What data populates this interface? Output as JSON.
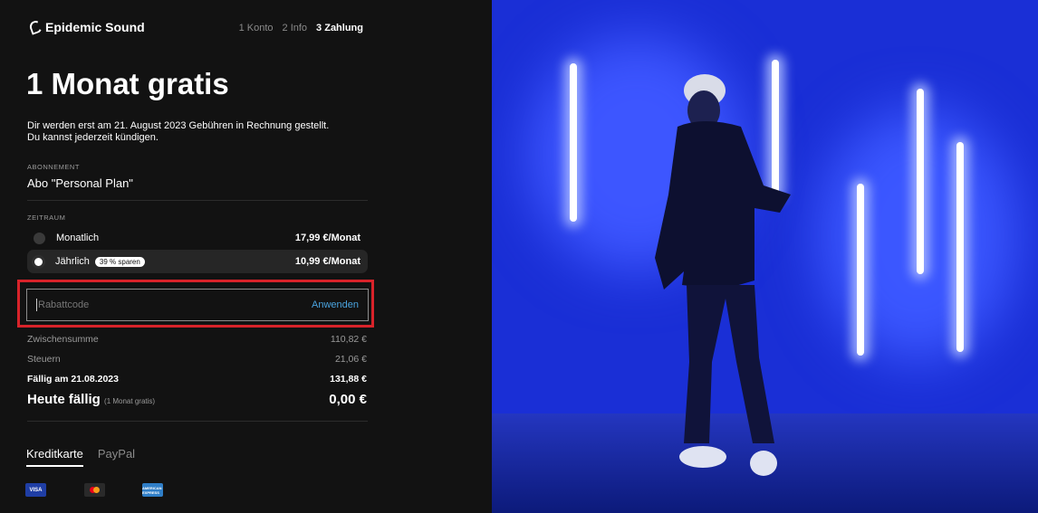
{
  "brand": {
    "name": "Epidemic Sound"
  },
  "steps": [
    {
      "label": "1 Konto"
    },
    {
      "label": "2 Info"
    },
    {
      "label": "3 Zahlung"
    }
  ],
  "headline": "1 Monat gratis",
  "notice": {
    "line1": "Dir werden erst am 21. August 2023 Gebühren in Rechnung gestellt.",
    "line2": "Du kannst jederzeit kündigen."
  },
  "subscription": {
    "label": "ABONNEMENT",
    "plan": "Abo \"Personal Plan\""
  },
  "period": {
    "label": "ZEITRAUM",
    "options": [
      {
        "label": "Monatlich",
        "badge": "",
        "price": "17,99 €/Monat",
        "selected": false
      },
      {
        "label": "Jährlich",
        "badge": "39 % sparen",
        "price": "10,99 €/Monat",
        "selected": true
      }
    ]
  },
  "coupon": {
    "placeholder": "Rabattcode",
    "apply_label": "Anwenden"
  },
  "summary": {
    "subtotal_label": "Zwischensumme",
    "subtotal_value": "110,82 €",
    "tax_label": "Steuern",
    "tax_value": "21,06 €",
    "due_date_label": "Fällig am 21.08.2023",
    "due_date_value": "131,88 €",
    "today_label": "Heute fällig",
    "today_note": "(1 Monat gratis)",
    "today_value": "0,00 €"
  },
  "payment": {
    "tabs": [
      {
        "label": "Kreditkarte",
        "active": true
      },
      {
        "label": "PayPal",
        "active": false
      }
    ],
    "cards": [
      {
        "name": "visa-icon",
        "text": "VISA"
      },
      {
        "name": "mastercard-icon",
        "text": ""
      },
      {
        "name": "amex-icon",
        "text": "AMERICAN EXPRESS"
      }
    ]
  },
  "colors": {
    "background": "#121212",
    "accent_link": "#4aa3df",
    "highlight_box": "#d8232a",
    "image_blue": "#1a2fd6"
  }
}
